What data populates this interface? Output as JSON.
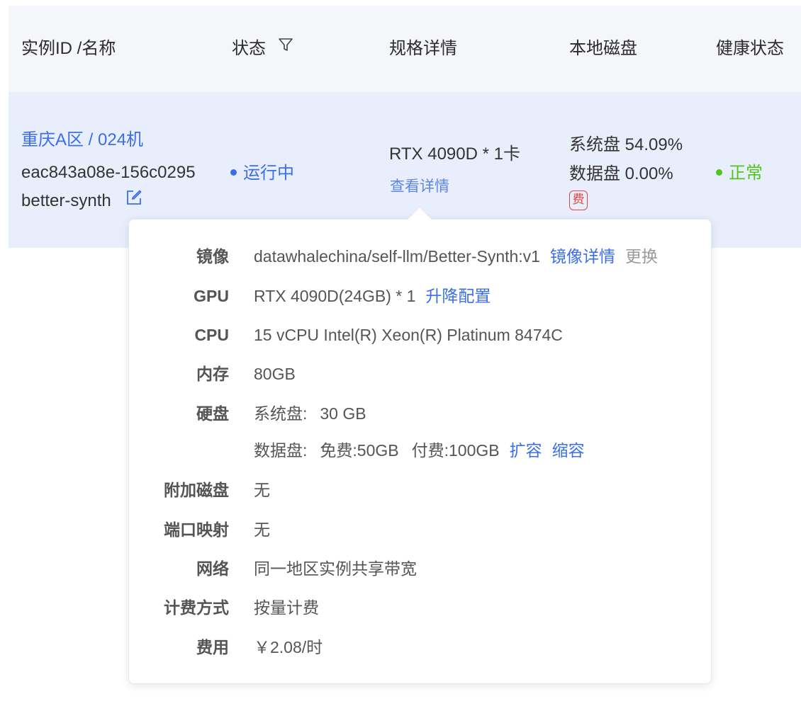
{
  "table": {
    "headers": {
      "instance": "实例ID /名称",
      "status": "状态",
      "spec": "规格详情",
      "disk": "本地磁盘",
      "health": "健康状态"
    },
    "row": {
      "region_name": "重庆A区 / 024机",
      "instance_id": "eac843a08e-156c0295",
      "name": "better-synth",
      "status": "运行中",
      "status_color": "#3b6ee8",
      "spec": "RTX 4090D * 1卡",
      "spec_detail_link": "查看详情",
      "system_disk": "系统盘 54.09%",
      "data_disk": "数据盘 0.00%",
      "fee_badge": "费",
      "health": "正常",
      "health_color": "#52c41a"
    }
  },
  "popover": {
    "image": {
      "label": "镜像",
      "value": "datawhalechina/self-llm/Better-Synth:v1",
      "detail_link": "镜像详情",
      "change_link": "更换"
    },
    "gpu": {
      "label": "GPU",
      "value": "RTX 4090D(24GB) * 1",
      "upgrade_link": "升降配置"
    },
    "cpu": {
      "label": "CPU",
      "value": "15 vCPU Intel(R) Xeon(R) Platinum 8474C"
    },
    "memory": {
      "label": "内存",
      "value": "80GB"
    },
    "disk": {
      "label": "硬盘",
      "system_label": "系统盘:",
      "system_value": "30 GB",
      "data_label": "数据盘:",
      "data_free": "免费:50GB",
      "data_paid": "付费:100GB",
      "expand_link": "扩容",
      "shrink_link": "缩容"
    },
    "extra_disk": {
      "label": "附加磁盘",
      "value": "无"
    },
    "port_mapping": {
      "label": "端口映射",
      "value": "无"
    },
    "network": {
      "label": "网络",
      "value": "同一地区实例共享带宽"
    },
    "billing": {
      "label": "计费方式",
      "value": "按量计费"
    },
    "cost": {
      "label": "费用",
      "value": "￥2.08/时"
    }
  },
  "icons": {
    "filter": "filter-icon",
    "edit": "edit-icon"
  }
}
